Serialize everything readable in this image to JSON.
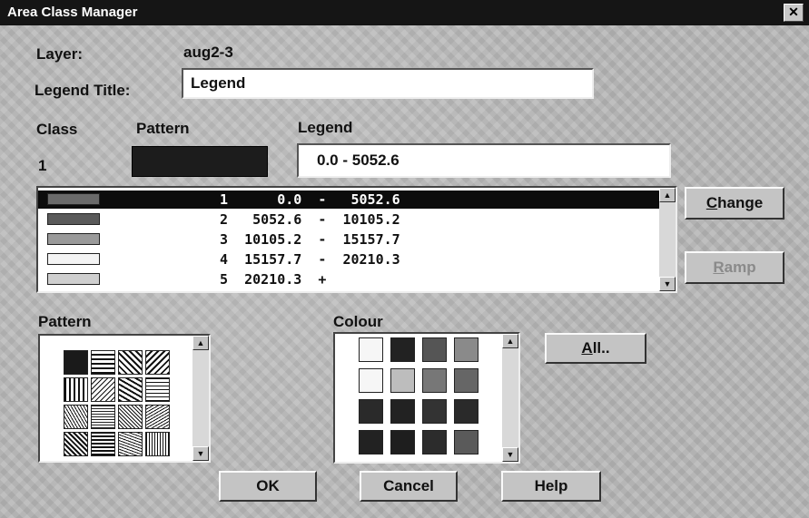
{
  "window": {
    "title": "Area Class Manager",
    "close_glyph": "✕"
  },
  "layer": {
    "label": "Layer:",
    "value": "aug2-3"
  },
  "legend_title": {
    "label": "Legend Title:",
    "value": "Legend"
  },
  "headers": {
    "class": "Class",
    "pattern": "Pattern",
    "legend": "Legend"
  },
  "current": {
    "class_number": "1",
    "legend_value": "0.0 - 5052.6",
    "pattern_color": "#1c1c1c"
  },
  "class_list": {
    "rows": [
      {
        "text": "1      0.0  -   5052.6",
        "selected": true,
        "swatch": "#6a6a6a"
      },
      {
        "text": "2   5052.6  -  10105.2",
        "selected": false,
        "swatch": "#5a5a5a"
      },
      {
        "text": "3  10105.2  -  15157.7",
        "selected": false,
        "swatch": "#9a9a9a"
      },
      {
        "text": "4  15157.7  -  20210.3",
        "selected": false,
        "swatch": "#f4f4f4"
      },
      {
        "text": "5  20210.3  +",
        "selected": false,
        "swatch": "#cfcfcf"
      }
    ]
  },
  "buttons": {
    "change_underlined": "C",
    "change_rest": "hange",
    "ramp_underlined": "R",
    "ramp_rest": "amp",
    "all_underlined": "A",
    "all_rest": "ll..",
    "ok": "OK",
    "cancel": "Cancel",
    "help": "Help"
  },
  "pattern_section": {
    "label": "Pattern"
  },
  "colour_section": {
    "label": "Colour"
  },
  "icons": {
    "scroll_up": "▲",
    "scroll_down": "▼"
  }
}
